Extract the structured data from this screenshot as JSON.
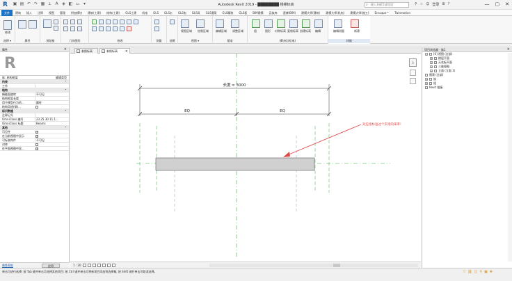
{
  "titlebar": {
    "logo": "R",
    "app_title": "Autodesk Revit 2019 - ████████ 楼梯标高",
    "search_placeholder": "键入关键字或短语",
    "sign_in": "登录",
    "window_controls": [
      "—",
      "▢",
      "✕"
    ]
  },
  "ribbon_tabs": [
    "文件",
    "建筑",
    "插入",
    "注释",
    "视图",
    "管理",
    "附加模块",
    "建筑(土建)",
    "结构(土建)",
    "GLS土建",
    "机电",
    "GLS",
    "GLS水",
    "GLS电",
    "GLS风",
    "GLS通用",
    "GLS精装",
    "GLS板",
    "BIM建模",
    "云族库",
    "速博(BIM)",
    "建模大师(建筑)",
    "建模大师(机电)",
    "建模大师(施工)",
    "Enscape™",
    "Twinmotion"
  ],
  "ribbon_active_tab": 0,
  "ribbon_groups": [
    {
      "label": "选择 ▾"
    },
    {
      "label": "属性"
    },
    {
      "label": "剪贴板"
    },
    {
      "label": "几何图形"
    },
    {
      "label": "修改"
    },
    {
      "label": "测量"
    },
    {
      "label": "创建"
    },
    {
      "label": "视图 ▾"
    },
    {
      "label": "基准"
    },
    {
      "label": "建模大师(通用)"
    },
    {
      "label": "模块化(机电)"
    },
    {
      "label": "样板"
    }
  ],
  "ribbon_tools": {
    "modify": "修改",
    "view_group": "视图",
    "select_links": "编辑",
    "plan": "视图区域",
    "tools": [
      "绘制区域",
      "编辑区域",
      "调整区域",
      "组",
      "图形",
      "对称标高",
      "复制标高",
      "创建标高",
      "编辑",
      "编辑测量",
      "创建",
      "新建"
    ]
  },
  "properties": {
    "title": "属性",
    "type_name": "族: 结构框架",
    "edit_type": "编辑类型",
    "sections": [
      {
        "type": "cat",
        "label": "约束"
      },
      {
        "type": "row",
        "label": "工作",
        "value": ""
      },
      {
        "type": "cat",
        "label": "结构"
      },
      {
        "type": "row",
        "label": "横截面旋转",
        "value": "不可见"
      },
      {
        "type": "row",
        "label": "结构框架长度",
        "value": ""
      },
      {
        "type": "row",
        "label": "用于模型行为的...",
        "value": "圆柱"
      },
      {
        "type": "row",
        "label": "结构用途(钢)...",
        "value": "",
        "checkbox": false
      },
      {
        "type": "cat",
        "label": "标识数据"
      },
      {
        "type": "row",
        "label": "注释记号",
        "value": ""
      },
      {
        "type": "row",
        "label": "OmniClass 编号",
        "value": "23.25.30.11.1..."
      },
      {
        "type": "row",
        "label": "OmniClass 标题",
        "value": "Beams"
      },
      {
        "type": "cat",
        "label": "其他"
      },
      {
        "type": "row",
        "label": "可见性",
        "value": "",
        "checkbox": true
      },
      {
        "type": "row",
        "label": "在当前视图中显示",
        "value": "",
        "checkbox": true
      },
      {
        "type": "row",
        "label": "可标准构件",
        "value": "不可见"
      },
      {
        "type": "row",
        "label": "对称",
        "value": "",
        "checkbox": false
      },
      {
        "type": "row",
        "label": "在平面视图中显...",
        "value": "",
        "checkbox": true
      }
    ],
    "help_link": "属性帮助",
    "apply": "应用"
  },
  "view_tabs": [
    {
      "label": "参照标高",
      "active": false
    },
    {
      "label": "参照标高",
      "active": true
    }
  ],
  "drawing": {
    "dimension_total": "长度 = 3000",
    "eq_left": "EQ",
    "eq_right": "EQ",
    "annotation": "对应指标准过个实现的来率!"
  },
  "view_control": {
    "scale": "1 : 20"
  },
  "navbar": {
    "cube_label": "上"
  },
  "project_browser": {
    "title": "项目浏览器 - 族1",
    "nodes": [
      {
        "depth": 0,
        "toggle": "−",
        "label": "[0] 视图 (全部)"
      },
      {
        "depth": 1,
        "toggle": "+",
        "label": "楼层平面"
      },
      {
        "depth": 1,
        "toggle": "+",
        "label": "天花板平面"
      },
      {
        "depth": 1,
        "toggle": "+",
        "label": "三维视图"
      },
      {
        "depth": 1,
        "toggle": "+",
        "label": "立面 (立面 1)"
      },
      {
        "depth": 0,
        "toggle": "",
        "label": "图表 (全部)"
      },
      {
        "depth": 0,
        "toggle": "+",
        "label": "族"
      },
      {
        "depth": 0,
        "toggle": "+",
        "label": "组"
      },
      {
        "depth": 0,
        "toggle": "",
        "label": "Revit 链接"
      }
    ]
  },
  "statusbar": {
    "message": "单击可进行选择; 按 Tab 键并单击可选择其他项目; 按 Ctrl 键并单击可将新项目添加到选择集; 按 Shift 键并单击可取消选择。"
  },
  "colors": {
    "accent": "#1b73c7",
    "guide_green": "#3aaa3a",
    "annotation_red": "#e04848",
    "beam_fill": "#d0d0d0"
  }
}
